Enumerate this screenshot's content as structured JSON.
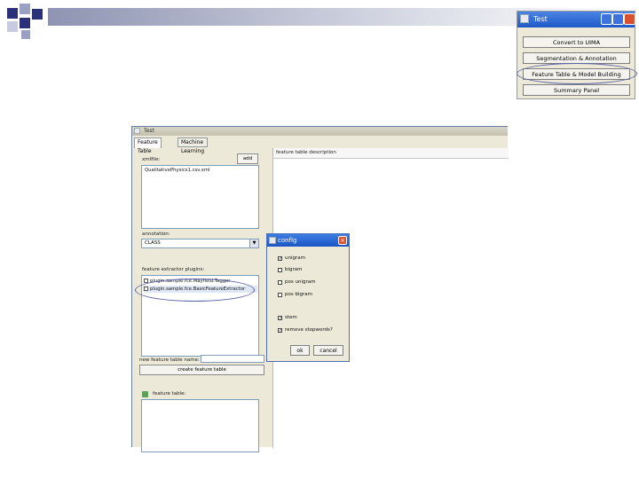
{
  "tool_window": {
    "title": "Test",
    "buttons": [
      "Convert to UIMA",
      "Segmentation & Annotation",
      "Feature Table & Model Building",
      "Summary Panel"
    ]
  },
  "main_window": {
    "title": "Test",
    "tabs": [
      "Feature Table",
      "Machine Learning"
    ],
    "left": {
      "xmlfile_label": "xmlfile:",
      "add_button": "add",
      "xmlfile_items": [
        "QualitativePhysics1.csv.xml"
      ],
      "annotation_label": "annotation:",
      "annotation_value": "CLASS",
      "plugins_label": "feature extractor plugins:",
      "plugins": [
        {
          "label": "plugin.sample.fce.Mayfield.Tagger",
          "checked": false
        },
        {
          "label": "plugin.sample.fce.BasicFeatureExtractor",
          "checked": true
        }
      ],
      "new_table_label": "new feature table name:",
      "new_table_value": "",
      "create_button": "create feature table",
      "feature_table_label": "feature table:"
    },
    "right": {
      "header": "feature table description"
    }
  },
  "config_dialog": {
    "title": "config",
    "options": [
      {
        "label": "unigram",
        "checked": true
      },
      {
        "label": "bigram",
        "checked": false
      },
      {
        "label": "pos unigram",
        "checked": false
      },
      {
        "label": "pos bigram",
        "checked": false
      },
      {
        "label": "stem",
        "checked": true
      },
      {
        "label": "remove stopwords?",
        "checked": true
      }
    ],
    "ok_button": "ok",
    "cancel_button": "cancel"
  },
  "colors": {
    "title_blue": "#1a52c4",
    "highlight_ellipse": "#5a64a8",
    "window_bg": "#ece9d8"
  }
}
